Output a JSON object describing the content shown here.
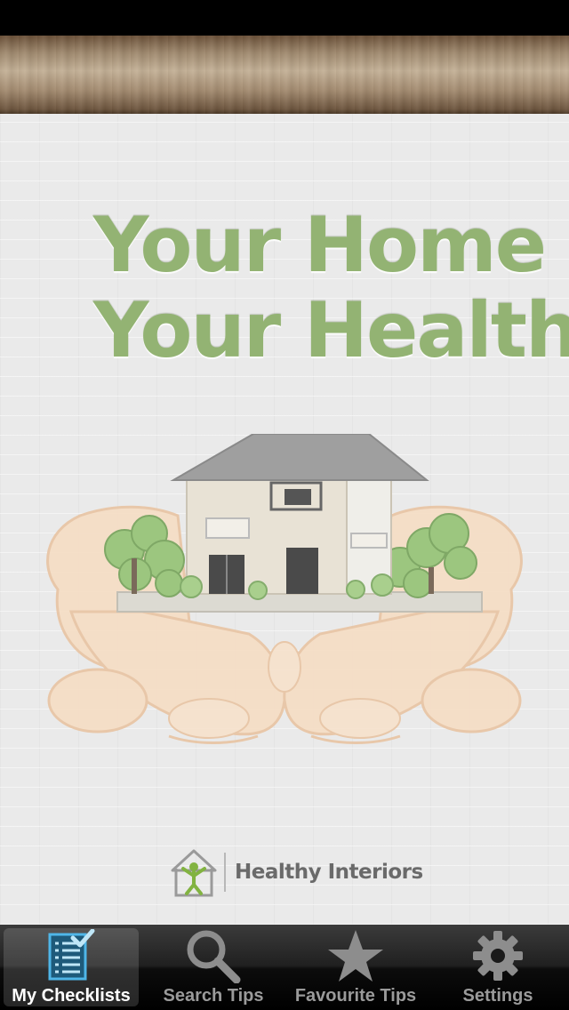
{
  "header": {
    "title_line_1": "Your Home",
    "title_line_2": "Your Health"
  },
  "illustration": {
    "icon": "house-in-hands-illustration"
  },
  "brand": {
    "name": "Healthy Interiors",
    "icon": "healthy-interiors-logo"
  },
  "tab_bar": {
    "active_index": 0,
    "tabs": [
      {
        "label": "My Checklists",
        "icon": "checklist-icon"
      },
      {
        "label": "Search Tips",
        "icon": "search-icon"
      },
      {
        "label": "Favourite Tips",
        "icon": "star-icon"
      },
      {
        "label": "Settings",
        "icon": "gear-icon"
      }
    ]
  },
  "colors": {
    "title_green": "#93b373",
    "active_tab_accent": "#4fb6e8",
    "tab_inactive_icon": "#8d8d8d"
  }
}
